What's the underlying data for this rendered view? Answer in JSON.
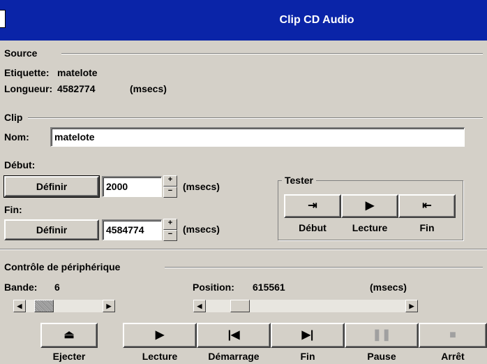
{
  "window": {
    "title": "Clip CD Audio"
  },
  "source": {
    "group_label": "Source",
    "etiquette_label": "Etiquette:",
    "etiquette_value": "matelote",
    "longueur_label": "Longueur:",
    "longueur_value": "4582774",
    "longueur_unit": "(msecs)"
  },
  "clip": {
    "group_label": "Clip",
    "nom_label": "Nom:",
    "nom_value": "matelote",
    "debut_label": "Début:",
    "debut_button": "Définir",
    "debut_value": "2000",
    "debut_unit": "(msecs)",
    "fin_label": "Fin:",
    "fin_button": "Définir",
    "fin_value": "4584774",
    "fin_unit": "(msecs)"
  },
  "tester": {
    "group_label": "Tester",
    "buttons": [
      {
        "label": "Début",
        "icon": "goto-start-icon"
      },
      {
        "label": "Lecture",
        "icon": "play-icon"
      },
      {
        "label": "Fin",
        "icon": "goto-end-icon"
      }
    ]
  },
  "device": {
    "group_label": "Contrôle de périphérique",
    "bande_label": "Bande:",
    "bande_value": "6",
    "position_label": "Position:",
    "position_value": "615561",
    "position_unit": "(msecs)",
    "track_scroll_fraction": 0.15,
    "position_scroll_fraction": 0.134
  },
  "toolbar": {
    "eject": "Ejecter",
    "play": "Lecture",
    "start": "Démarrage",
    "end": "Fin",
    "pause": "Pause",
    "stop": "Arrêt"
  },
  "colors": {
    "titlebar": "#0a24a8",
    "face": "#d4d0c8"
  }
}
